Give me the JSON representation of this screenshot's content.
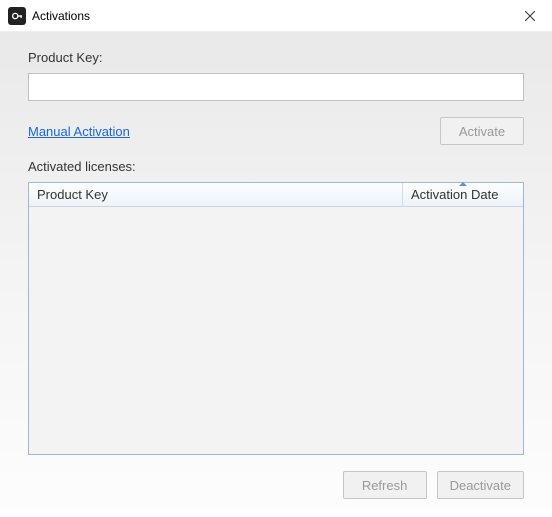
{
  "window": {
    "title": "Activations"
  },
  "labels": {
    "productKey": "Product Key:",
    "activatedLicenses": "Activated licenses:"
  },
  "input": {
    "productKeyValue": ""
  },
  "link": {
    "manualActivation": "Manual Activation"
  },
  "buttons": {
    "activate": "Activate",
    "refresh": "Refresh",
    "deactivate": "Deactivate"
  },
  "table": {
    "headers": {
      "productKey": "Product Key",
      "activationDate": "Activation Date"
    },
    "rows": []
  }
}
